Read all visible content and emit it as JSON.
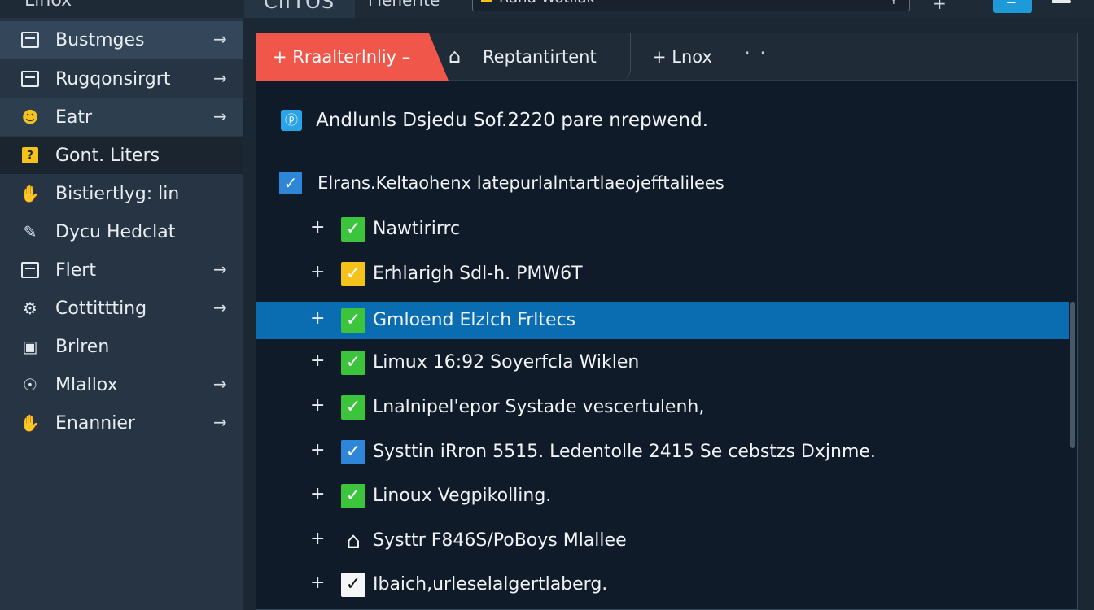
{
  "topbar": {
    "title": "Linox",
    "tab_label": "CIfTOS",
    "menu_label": "Flenerite",
    "search_value": "Rand Wotilak",
    "plus": "+",
    "blue_button": "☱"
  },
  "sidebar": {
    "items": [
      {
        "label": "Bustmges",
        "icon": "folder-icon",
        "arrow": "→"
      },
      {
        "label": "Rugqonsirgrt",
        "icon": "briefcase-icon",
        "arrow": "→"
      },
      {
        "label": "Eatr",
        "icon": "user-icon",
        "arrow": "→"
      },
      {
        "label": "Gont. Liters",
        "icon": "warning-icon",
        "arrow": ""
      },
      {
        "label": "Bistiertlyg: lin",
        "icon": "hand-icon",
        "arrow": ""
      },
      {
        "label": "Dycu Hedclat",
        "icon": "pen-icon",
        "arrow": ""
      },
      {
        "label": "Flert",
        "icon": "clipboard-icon",
        "arrow": "→"
      },
      {
        "label": "Cottittting",
        "icon": "settings-icon",
        "arrow": "→"
      },
      {
        "label": "Brlren",
        "icon": "device-icon",
        "arrow": ""
      },
      {
        "label": "Mlallox",
        "icon": "target-icon",
        "arrow": "→"
      },
      {
        "label": "Enannier",
        "icon": "hand-icon",
        "arrow": "→"
      }
    ]
  },
  "main": {
    "tabs": [
      {
        "label": "+ Rraalterlnliy –"
      },
      {
        "label": "Reptantirtent"
      },
      {
        "label": "+ Lnox"
      }
    ],
    "tab_more": "· ·",
    "header_icon": "ⓟ",
    "header_text": "Andlunls Dsjedu Sof.2220 pare nrepwend.",
    "section_label": "Elrans.Keltaohenx latepurlalntartlaeojefftalilees",
    "rows": [
      {
        "label": "Nawtirirrc",
        "check": "green"
      },
      {
        "label": "Erhlarigh Sdl-h. PMW6T",
        "check": "yellow"
      },
      {
        "label": "Gmloend Elzlch Frltecs",
        "check": "green",
        "selected": true
      },
      {
        "label": "Limux 16:92 Soyerfcla Wiklen",
        "check": "green"
      },
      {
        "label": "Lnalnipel'epor Systade vescertulenh,",
        "check": "green"
      },
      {
        "label": "Systtin iRron 5515. Ledentolle 2415 Se cebstzs Dxjnme.",
        "check": "blue"
      },
      {
        "label": "Linoux Vegpikolling.",
        "check": "green"
      },
      {
        "label": "Systtr F846S/PoBoys Mlallee",
        "check": "house"
      },
      {
        "label": "Ibaich,urleselalgertlaberg.",
        "check": "white"
      }
    ]
  },
  "colors": {
    "accent_red": "#f0574a",
    "selection_blue": "#0b6db1",
    "check_green": "#3cc43c",
    "check_yellow": "#f4c21a"
  }
}
